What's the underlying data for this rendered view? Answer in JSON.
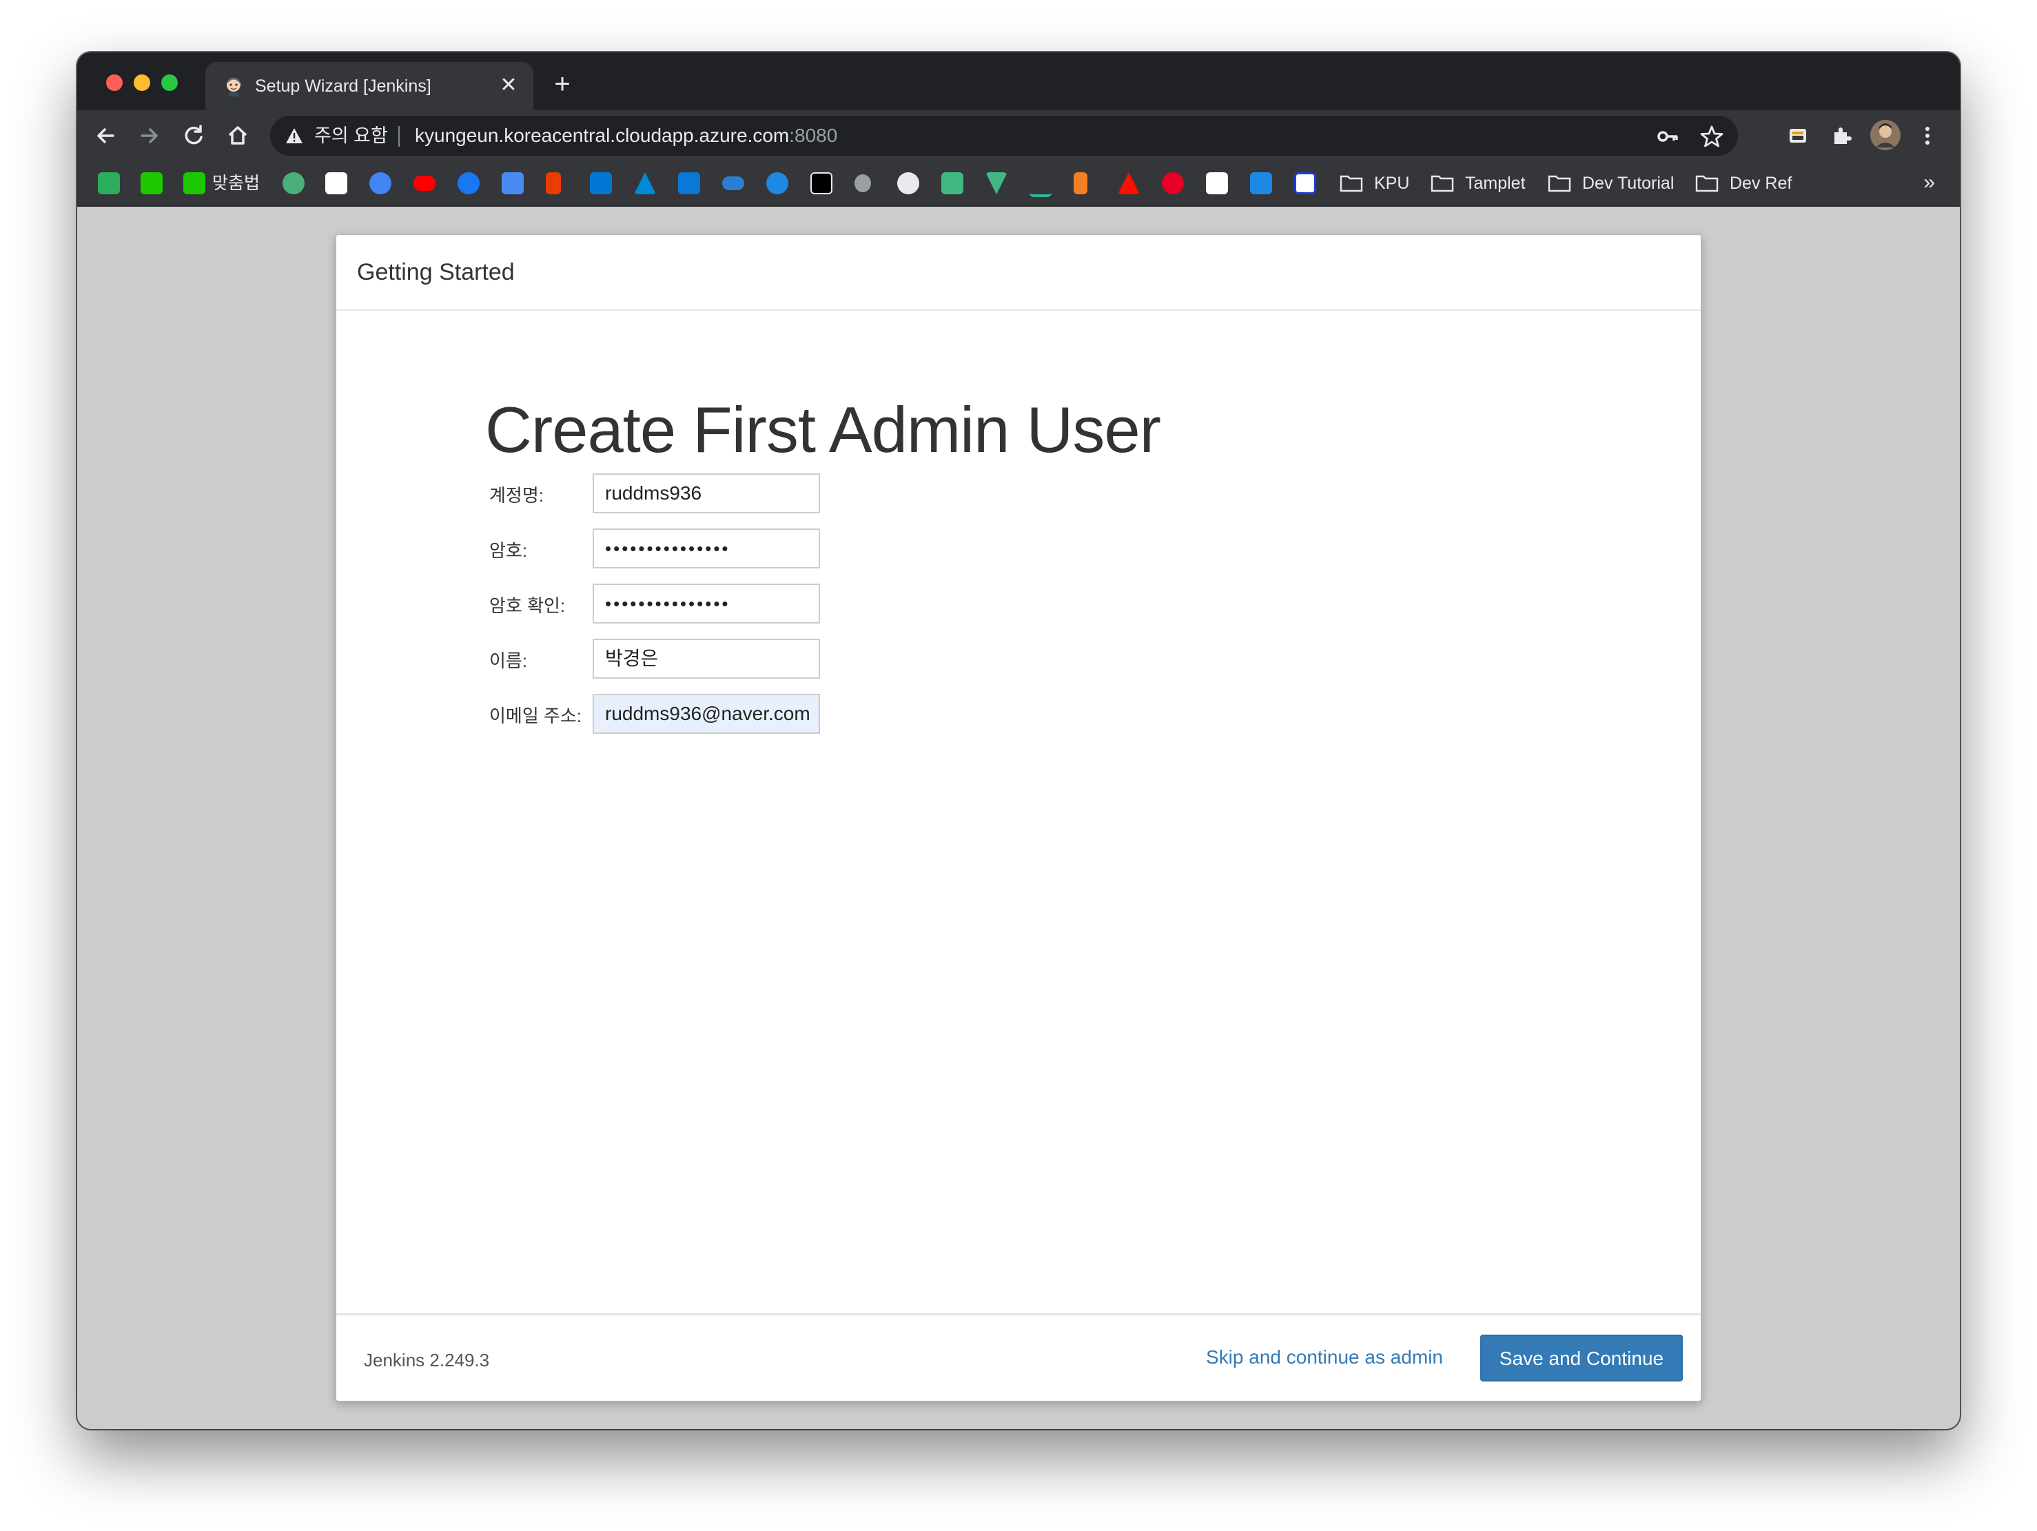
{
  "browser": {
    "tab_title": "Setup Wizard [Jenkins]",
    "tab_close": "✕",
    "new_tab": "+",
    "security_warning": "주의 요함",
    "url_host": "kyungeun.koreacentral.cloudapp.azure.com",
    "url_port": ":8080",
    "bookmarks": {
      "matchup_label": "맞춤법",
      "folders": [
        "KPU",
        "Tamplet",
        "Dev Tutorial",
        "Dev Ref"
      ],
      "more": "»"
    }
  },
  "dialog": {
    "header_title": "Getting Started",
    "heading": "Create First Admin User",
    "fields": [
      {
        "label": "계정명:",
        "value": "ruddms936"
      },
      {
        "label": "암호:",
        "value": "•••••••••••••••"
      },
      {
        "label": "암호 확인:",
        "value": "•••••••••••••••"
      },
      {
        "label": "이름:",
        "value": "박경은"
      },
      {
        "label": "이메일 주소:",
        "value": "ruddms936@naver.com"
      }
    ],
    "version": "Jenkins 2.249.3",
    "skip_label": "Skip and continue as admin",
    "save_label": "Save and Continue"
  },
  "colors": {
    "primary_button": "#337ab7",
    "link": "#337ab7",
    "viewport_bg": "#cccccc",
    "autofill_bg": "#e8f0fe"
  }
}
